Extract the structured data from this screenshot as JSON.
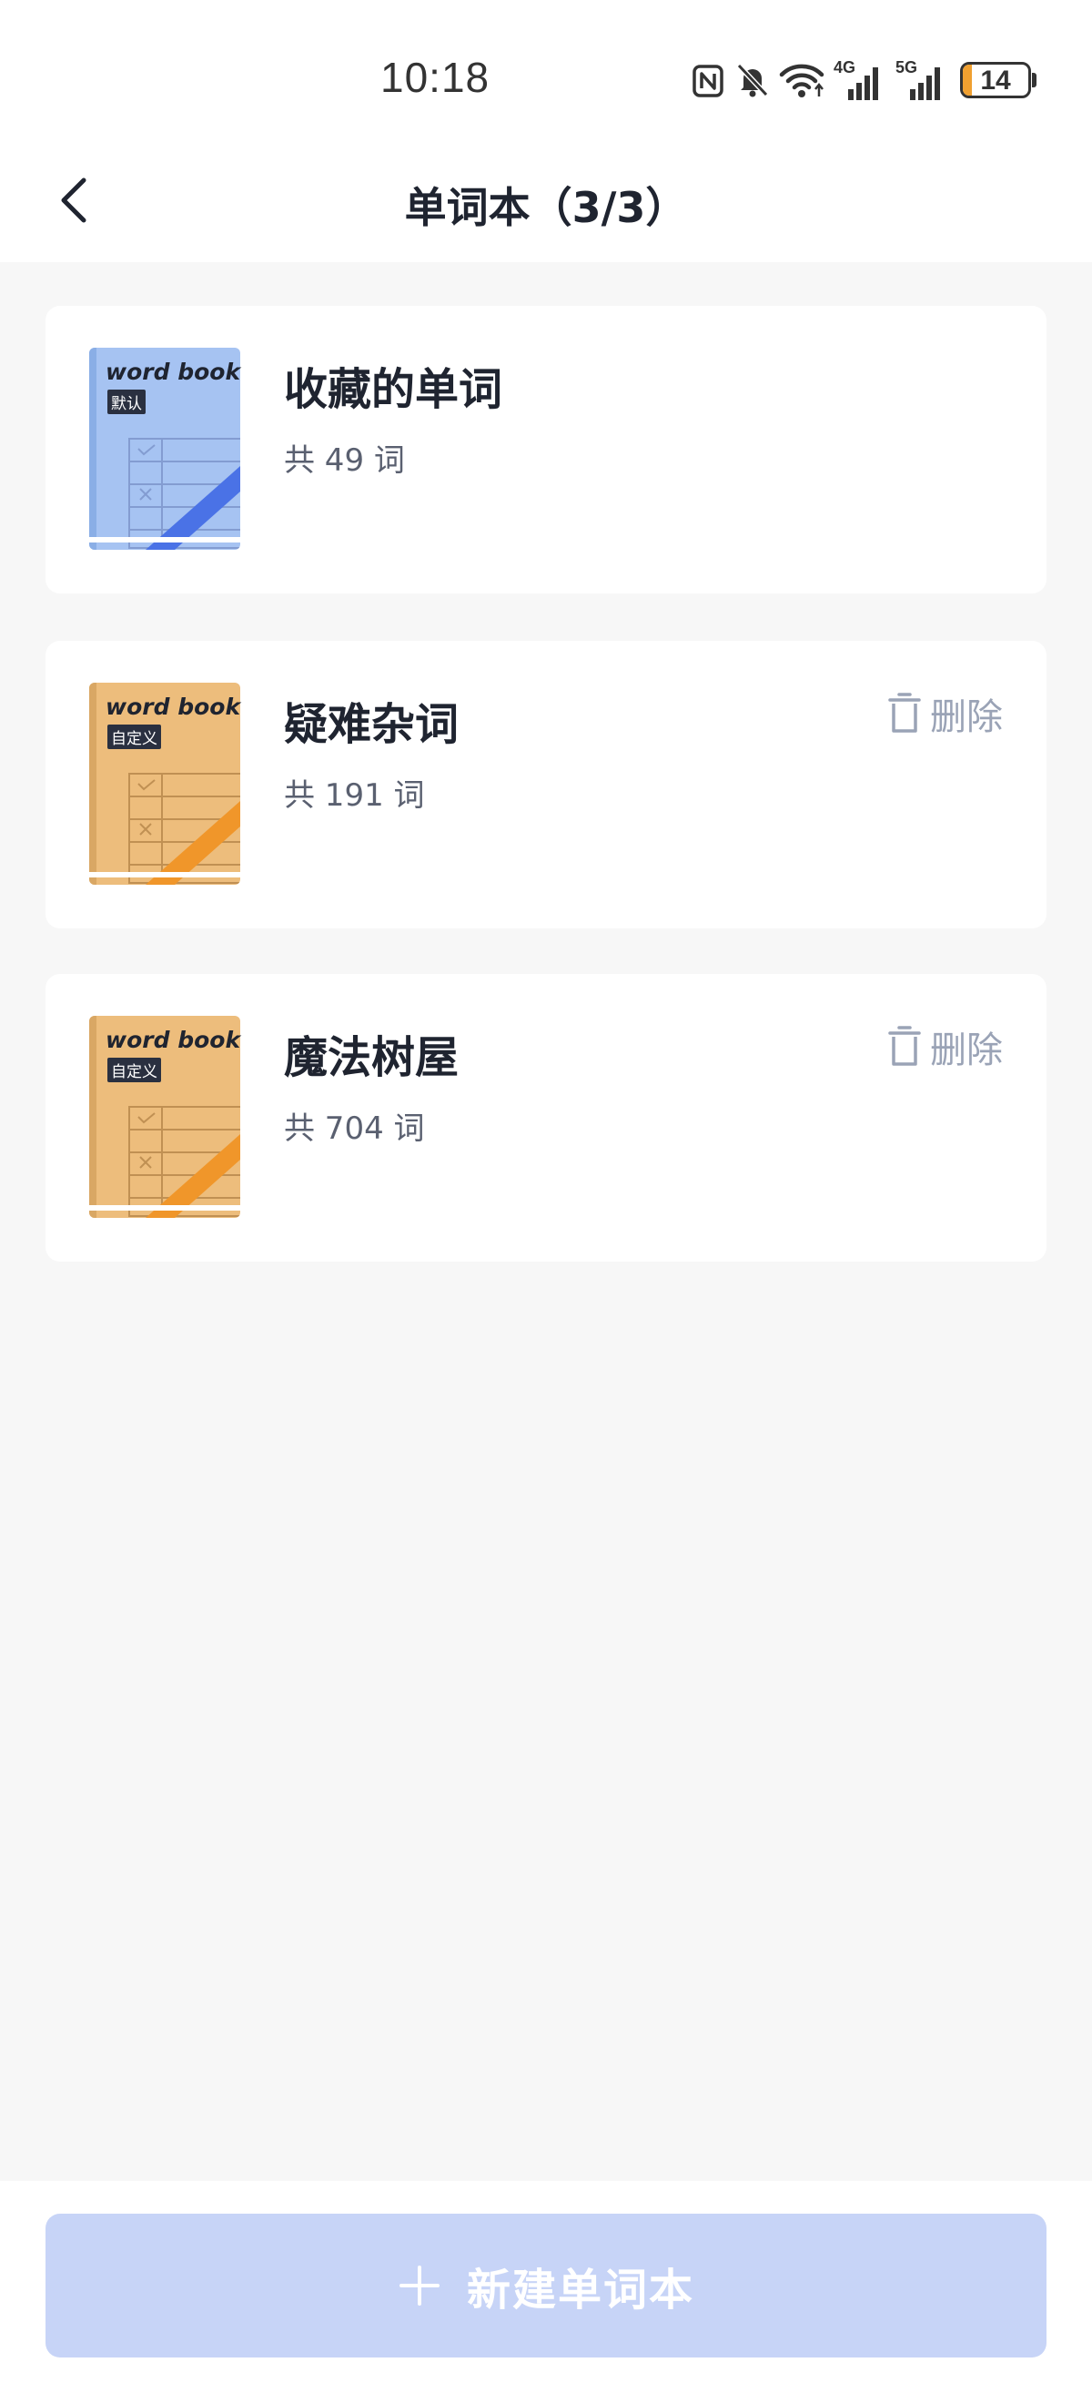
{
  "status_bar": {
    "time": "10:18",
    "network_4g": "4G",
    "network_5g": "5G",
    "battery": "14",
    "battery_level": 0.14
  },
  "header": {
    "title": "单词本（3/3）"
  },
  "wordbooks": [
    {
      "title": "收藏的单词",
      "count": "共 49 词",
      "cover_title": "word book",
      "cover_tag": "默认",
      "theme": "blue",
      "deletable": false
    },
    {
      "title": "疑难杂词",
      "count": "共 191 词",
      "cover_title": "word book",
      "cover_tag": "自定义",
      "theme": "orange",
      "deletable": true,
      "delete_label": "删除"
    },
    {
      "title": "魔法树屋",
      "count": "共 704 词",
      "cover_title": "word book",
      "cover_tag": "自定义",
      "theme": "orange",
      "deletable": true,
      "delete_label": "删除"
    }
  ],
  "footer": {
    "create_label": "新建单词本"
  },
  "colors": {
    "blue_cover": "#a6c3f2",
    "blue_stripe": "#4a72e6",
    "orange_cover": "#edbd7c",
    "orange_stripe": "#f0962a",
    "create_button": "#c7d4f7",
    "delete_text": "#9aa3b6"
  }
}
